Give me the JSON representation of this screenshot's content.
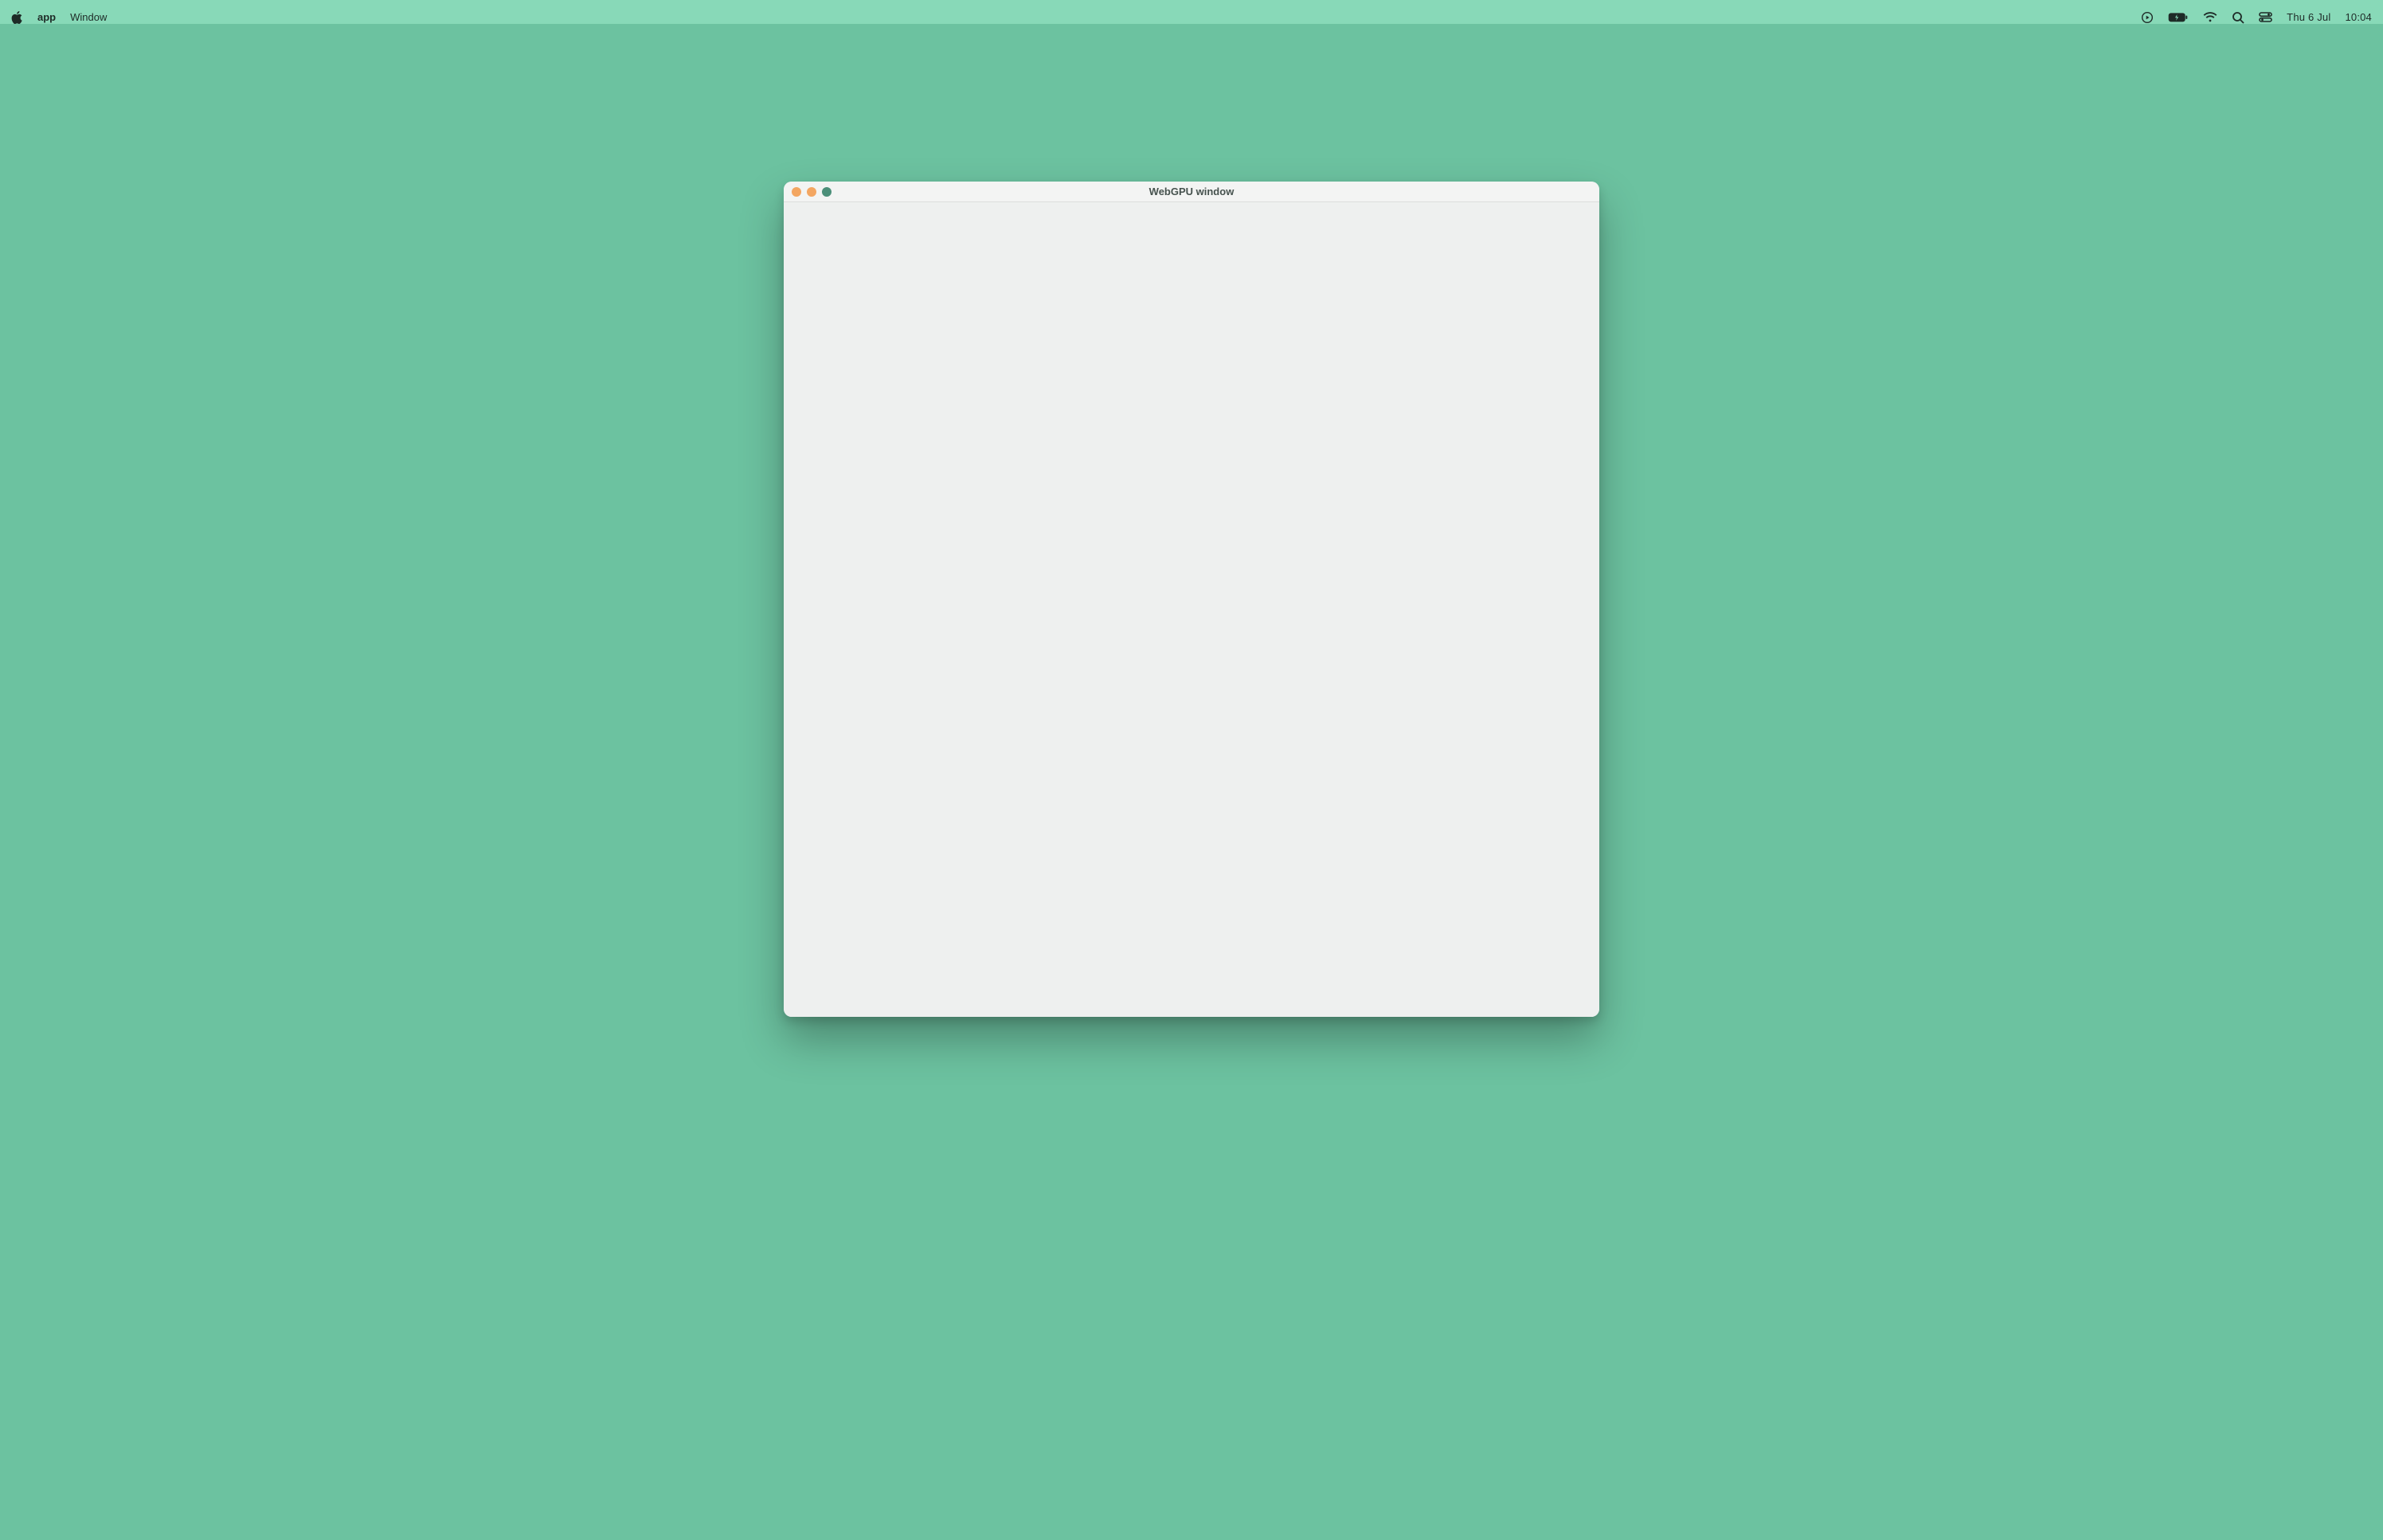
{
  "menubar": {
    "app_name": "app",
    "menus": [
      "Window"
    ],
    "status": {
      "date": "Thu 6 Jul",
      "time": "10:04"
    }
  },
  "window": {
    "title": "WebGPU window"
  }
}
